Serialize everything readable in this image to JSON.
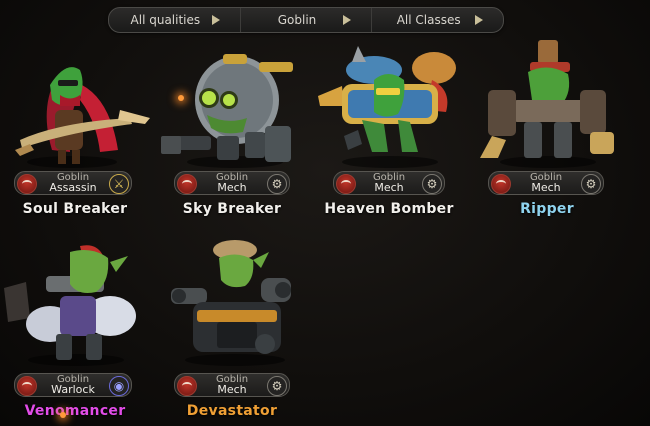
{
  "filters": [
    {
      "label": "All qualities",
      "icon": "play-triangle-icon"
    },
    {
      "label": "Goblin",
      "icon": "play-triangle-icon"
    },
    {
      "label": "All Classes",
      "icon": "play-triangle-icon"
    }
  ],
  "heroes": [
    {
      "name": "Soul Breaker",
      "race": "Goblin",
      "class": "Assassin",
      "class_icon": "crossed-blades-icon",
      "quality": "common",
      "name_color": "#f2f0ec"
    },
    {
      "name": "Sky Breaker",
      "race": "Goblin",
      "class": "Mech",
      "class_icon": "gear-icon",
      "quality": "common",
      "name_color": "#f2f0ec"
    },
    {
      "name": "Heaven Bomber",
      "race": "Goblin",
      "class": "Mech",
      "class_icon": "gear-icon",
      "quality": "common",
      "name_color": "#f2f0ec"
    },
    {
      "name": "Ripper",
      "race": "Goblin",
      "class": "Mech",
      "class_icon": "gear-icon",
      "quality": "rare",
      "name_color": "#8fd3ee"
    },
    {
      "name": "Venomancer",
      "race": "Goblin",
      "class": "Warlock",
      "class_icon": "warlock-icon",
      "quality": "epic",
      "name_color": "#e24de8"
    },
    {
      "name": "Devastator",
      "race": "Goblin",
      "class": "Mech",
      "class_icon": "gear-icon",
      "quality": "legendary",
      "name_color": "#f0a035"
    }
  ]
}
